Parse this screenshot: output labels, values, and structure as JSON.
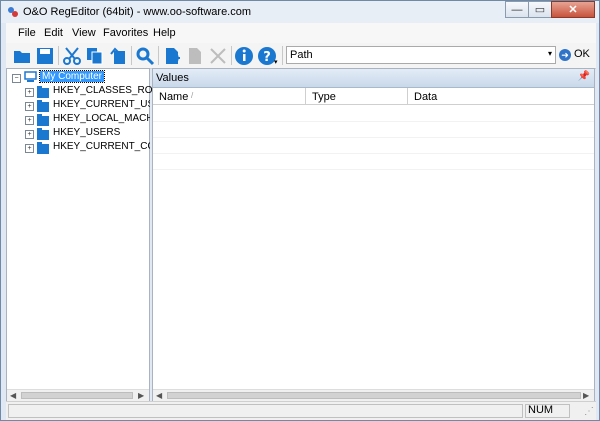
{
  "window": {
    "title": "O&O RegEditor (64bit) - www.oo-software.com"
  },
  "titlebar_buttons": {
    "minimize": "—",
    "maximize": "▭",
    "close": "✕"
  },
  "menu": {
    "items": [
      "File",
      "Edit",
      "View",
      "Favorites",
      "Help"
    ]
  },
  "toolbar": {
    "path_label": "Path",
    "ok_label": "OK",
    "icons": [
      "open-folder-icon",
      "save-icon",
      "cut-icon",
      "copy-icon",
      "paste-icon",
      "search-icon",
      "new-key-icon",
      "new-value-icon",
      "delete-icon",
      "info-icon",
      "help-icon"
    ]
  },
  "tree": {
    "root": "My Computer",
    "hives": [
      "HKEY_CLASSES_ROOT",
      "HKEY_CURRENT_USER",
      "HKEY_LOCAL_MACHINE",
      "HKEY_USERS",
      "HKEY_CURRENT_CONFIG"
    ]
  },
  "values_pane": {
    "title": "Values",
    "columns": [
      "Name",
      "Type",
      "Data"
    ]
  },
  "status": {
    "num": "NUM"
  },
  "colors": {
    "folder": "#1b78d0",
    "header_blue": "#c9d8ea",
    "selection": "#3399ff"
  }
}
